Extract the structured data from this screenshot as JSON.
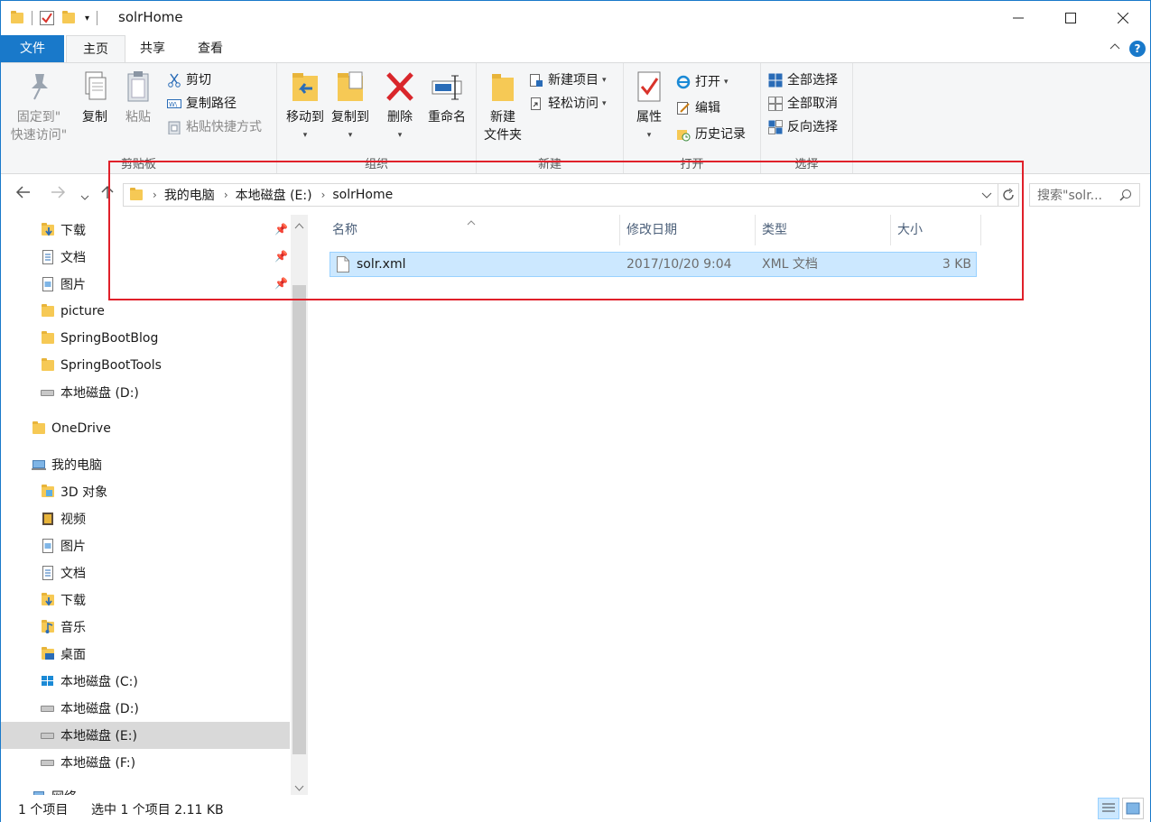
{
  "window": {
    "title": "solrHome"
  },
  "ribbon_tabs": [
    {
      "label": "文件"
    },
    {
      "label": "主页"
    },
    {
      "label": "共享"
    },
    {
      "label": "查看"
    }
  ],
  "ribbon": {
    "clipboard": {
      "group_label": "剪贴板",
      "pin": "固定到\"\n快速访问\"",
      "pin_line1": "固定到\"",
      "pin_line2": "快速访问\"",
      "copy": "复制",
      "paste": "粘贴",
      "cut": "剪切",
      "copy_path": "复制路径",
      "paste_shortcut": "粘贴快捷方式"
    },
    "organize": {
      "group_label": "组织",
      "move_to": "移动到",
      "copy_to": "复制到",
      "delete": "删除",
      "rename": "重命名"
    },
    "new": {
      "group_label": "新建",
      "new_folder_line1": "新建",
      "new_folder_line2": "文件夹",
      "new_item": "新建项目",
      "easy_access": "轻松访问"
    },
    "open": {
      "group_label": "打开",
      "properties": "属性",
      "open": "打开",
      "edit": "编辑",
      "history": "历史记录"
    },
    "select": {
      "group_label": "选择",
      "select_all": "全部选择",
      "select_none": "全部取消",
      "invert": "反向选择"
    }
  },
  "address": {
    "crumbs": [
      "我的电脑",
      "本地磁盘 (E:)",
      "solrHome"
    ],
    "search_placeholder": "搜索\"solr..."
  },
  "nav_pane": {
    "quick_access": [
      {
        "label": "下载",
        "pinned": true
      },
      {
        "label": "文档",
        "pinned": true
      },
      {
        "label": "图片",
        "pinned": true
      },
      {
        "label": "picture"
      },
      {
        "label": "SpringBootBlog"
      },
      {
        "label": "SpringBootTools"
      },
      {
        "label": "本地磁盘 (D:)"
      }
    ],
    "onedrive": "OneDrive",
    "this_pc": "我的电脑",
    "pc_items": [
      {
        "label": "3D 对象"
      },
      {
        "label": "视频"
      },
      {
        "label": "图片"
      },
      {
        "label": "文档"
      },
      {
        "label": "下载"
      },
      {
        "label": "音乐"
      },
      {
        "label": "桌面"
      },
      {
        "label": "本地磁盘 (C:)"
      },
      {
        "label": "本地磁盘 (D:)"
      },
      {
        "label": "本地磁盘 (E:)",
        "selected": true
      },
      {
        "label": "本地磁盘 (F:)"
      }
    ],
    "network": "网络"
  },
  "file_list": {
    "columns": [
      "名称",
      "修改日期",
      "类型",
      "大小"
    ],
    "rows": [
      {
        "name": "solr.xml",
        "modified": "2017/10/20 9:04",
        "type": "XML 文档",
        "size": "3 KB"
      }
    ]
  },
  "status_bar": {
    "item_count": "1 个项目",
    "selected": "选中 1 个项目  2.11 KB"
  },
  "colors": {
    "accent": "#1979ca",
    "selection": "#cce8ff",
    "highlight_box": "#e0202a"
  }
}
